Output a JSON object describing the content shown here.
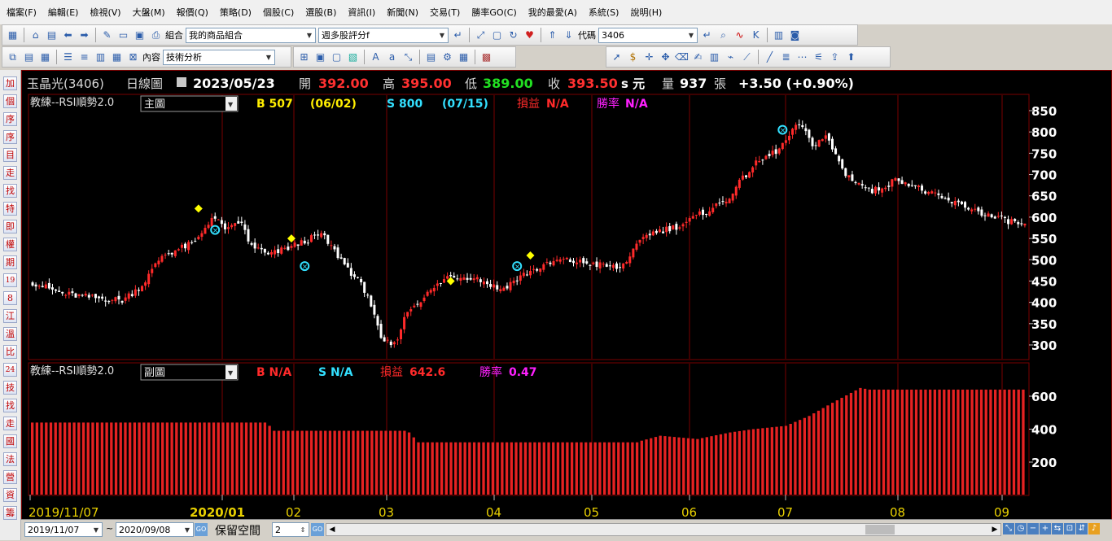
{
  "menu": [
    "檔案(F)",
    "編輯(E)",
    "檢視(V)",
    "大盤(M)",
    "報價(Q)",
    "策略(D)",
    "個股(C)",
    "選股(B)",
    "資訊(I)",
    "新聞(N)",
    "交易(T)",
    "勝率GO(C)",
    "我的最愛(A)",
    "系統(S)",
    "說明(H)"
  ],
  "toolbar1": {
    "portfolio_label": "組合",
    "portfolio_value": "我的商品組合",
    "screener_value": "週多股評分f",
    "code_label": "代碼",
    "code_value": "3406"
  },
  "toolbar2": {
    "content_label": "內容",
    "content_value": "技術分析"
  },
  "sidebar_items": [
    "加",
    "個",
    "序",
    "序",
    "目",
    "走",
    "找",
    "特",
    "即",
    "權",
    "期",
    "19",
    "8",
    "江",
    "溫",
    "比",
    "24",
    "技",
    "找",
    "走",
    "國",
    "法",
    "營",
    "資",
    "籌"
  ],
  "quote": {
    "name": "玉晶光(3406)",
    "period": "日線圖",
    "date": "2023/05/23",
    "open_label": "開",
    "open": "392.00",
    "high_label": "高",
    "high": "395.00",
    "low_label": "低",
    "low": "389.00",
    "close_label": "收",
    "close": "393.50",
    "unit": "s 元",
    "vol_label": "量",
    "volume": "937",
    "vol_unit": "張",
    "change": "+3.50 (+0.90%)"
  },
  "main_panel": {
    "indicator": "教練--RSI順勢2.0",
    "selector": "主圖",
    "buy": "B 507",
    "buy_date": "(06/02)",
    "sell": "S 800",
    "sell_date": "(07/15)",
    "pnl_label": "損益",
    "pnl": "N/A",
    "win_label": "勝率",
    "win": "N/A"
  },
  "sub_panel": {
    "indicator": "教練--RSI順勢2.0",
    "selector": "副圖",
    "buy": "B N/A",
    "sell": "S N/A",
    "pnl_label": "損益",
    "pnl": "642.6",
    "win_label": "勝率",
    "win": "0.47"
  },
  "x_axis_labels": [
    "2019/11/07",
    "2020/01",
    "02",
    "03",
    "04",
    "05",
    "06",
    "07",
    "08",
    "09"
  ],
  "bottom": {
    "start_date": "2019/11/07",
    "end_date": "2020/09/08",
    "tilde": "~",
    "keep_label": "保留空間",
    "keep_value": "2",
    "go": "GO"
  },
  "colors": {
    "up": "#ff2a2a",
    "down": "#ffffff",
    "grid": "#7a0000",
    "buy_marker": "#ffff00",
    "sell_marker": "#33e0ff",
    "bar": "#e62222"
  },
  "chart_data": [
    {
      "type": "candlestick",
      "title": "教練--RSI順勢2.0",
      "ylim": [
        270,
        860
      ],
      "yticks": [
        300,
        350,
        400,
        450,
        500,
        550,
        600,
        650,
        700,
        750,
        800,
        850
      ],
      "x_labels": [
        "2019/11/07",
        "2020/01",
        "02",
        "03",
        "04",
        "05",
        "06",
        "07",
        "08",
        "09"
      ],
      "anchors": [
        [
          0,
          450
        ],
        [
          10,
          420
        ],
        [
          20,
          410
        ],
        [
          28,
          405
        ],
        [
          34,
          440
        ],
        [
          40,
          510
        ],
        [
          50,
          540
        ],
        [
          55,
          600
        ],
        [
          60,
          570
        ],
        [
          64,
          590
        ],
        [
          66,
          540
        ],
        [
          72,
          510
        ],
        [
          82,
          540
        ],
        [
          88,
          560
        ],
        [
          96,
          480
        ],
        [
          102,
          420
        ],
        [
          106,
          310
        ],
        [
          110,
          300
        ],
        [
          114,
          380
        ],
        [
          120,
          420
        ],
        [
          126,
          460
        ],
        [
          134,
          460
        ],
        [
          142,
          430
        ],
        [
          150,
          470
        ],
        [
          160,
          500
        ],
        [
          170,
          490
        ],
        [
          178,
          480
        ],
        [
          186,
          560
        ],
        [
          196,
          580
        ],
        [
          210,
          640
        ],
        [
          218,
          720
        ],
        [
          226,
          760
        ],
        [
          232,
          820
        ],
        [
          236,
          770
        ],
        [
          240,
          790
        ],
        [
          246,
          700
        ],
        [
          254,
          660
        ],
        [
          262,
          690
        ],
        [
          270,
          660
        ],
        [
          276,
          640
        ],
        [
          284,
          620
        ],
        [
          290,
          600
        ],
        [
          296,
          590
        ],
        [
          300,
          580
        ]
      ],
      "signals": [
        {
          "kind": "buy",
          "x": 50,
          "y": 620
        },
        {
          "kind": "sell",
          "x": 55,
          "y": 570
        },
        {
          "kind": "buy",
          "x": 78,
          "y": 550
        },
        {
          "kind": "sell",
          "x": 82,
          "y": 485
        },
        {
          "kind": "buy",
          "x": 126,
          "y": 450
        },
        {
          "kind": "sell",
          "x": 146,
          "y": 485
        },
        {
          "kind": "buy",
          "x": 150,
          "y": 510
        },
        {
          "kind": "sell",
          "x": 226,
          "y": 805
        }
      ]
    },
    {
      "type": "bar",
      "title": "教練--RSI順勢2.0 副圖",
      "ylim": [
        0,
        680
      ],
      "yticks": [
        200,
        400,
        600
      ],
      "segments": [
        [
          0,
          440
        ],
        [
          50,
          440
        ],
        [
          51,
          420
        ],
        [
          52,
          390
        ],
        [
          80,
          390
        ],
        [
          81,
          380
        ],
        [
          83,
          320
        ],
        [
          130,
          320
        ],
        [
          131,
          330
        ],
        [
          135,
          360
        ],
        [
          139,
          350
        ],
        [
          143,
          340
        ],
        [
          150,
          380
        ],
        [
          155,
          400
        ],
        [
          162,
          420
        ],
        [
          167,
          480
        ],
        [
          172,
          560
        ],
        [
          176,
          620
        ],
        [
          178,
          650
        ],
        [
          180,
          640
        ],
        [
          185,
          640
        ],
        [
          213,
          640
        ]
      ]
    }
  ]
}
